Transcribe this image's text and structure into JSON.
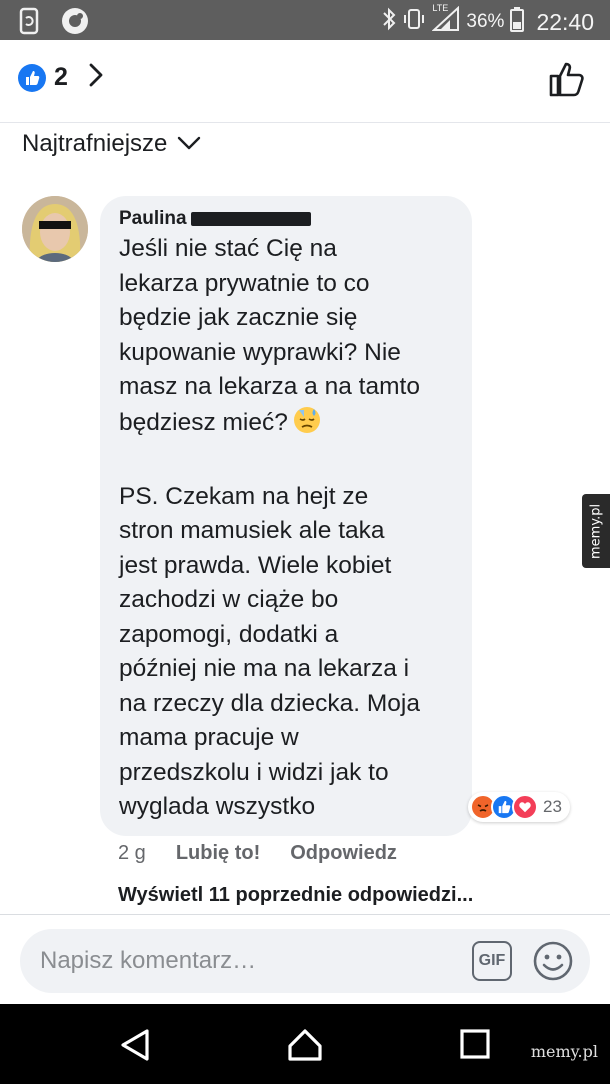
{
  "status_bar": {
    "network": "LTE",
    "battery": "36%",
    "time": "22:40"
  },
  "header": {
    "like_count": "2"
  },
  "sort": {
    "label": "Najtrafniejsze"
  },
  "comment": {
    "author": "Paulina",
    "paragraph_1": "Jeśli nie stać Cię na\nlekarza prywatnie to co\nbędzie jak zacznie się\nkupowanie wyprawki? Nie\nmasz na lekarza a na tamto\nbędziesz mieć?",
    "paragraph_2": "PS. Czekam na hejt ze\nstron mamusiek ale taka\njest prawda. Wiele kobiet\nzachodzi w ciąże bo\nzapomogi, dodatki a\npóźniej nie ma na lekarza i\nna rzeczy dla dziecka. Moja\nmama pracuje w\nprzedszkolu i widzi jak to\nwyglada wszystko",
    "reaction_count": "23",
    "reactions": [
      "angry",
      "like",
      "love"
    ],
    "time": "2 g",
    "like_action": "Lubię to!",
    "reply_action": "Odpowiedz"
  },
  "previous_replies": "Wyświetl 11 poprzednie odpowiedzi...",
  "composer": {
    "placeholder": "Napisz komentarz…",
    "gif_label": "GIF"
  },
  "watermark": {
    "side": "memy.pl",
    "bottom": "memy.pl"
  },
  "colors": {
    "facebook_blue": "#1877f2",
    "bubble_bg": "#f0f2f5",
    "angry": "#f0642a",
    "love": "#f33e58"
  }
}
